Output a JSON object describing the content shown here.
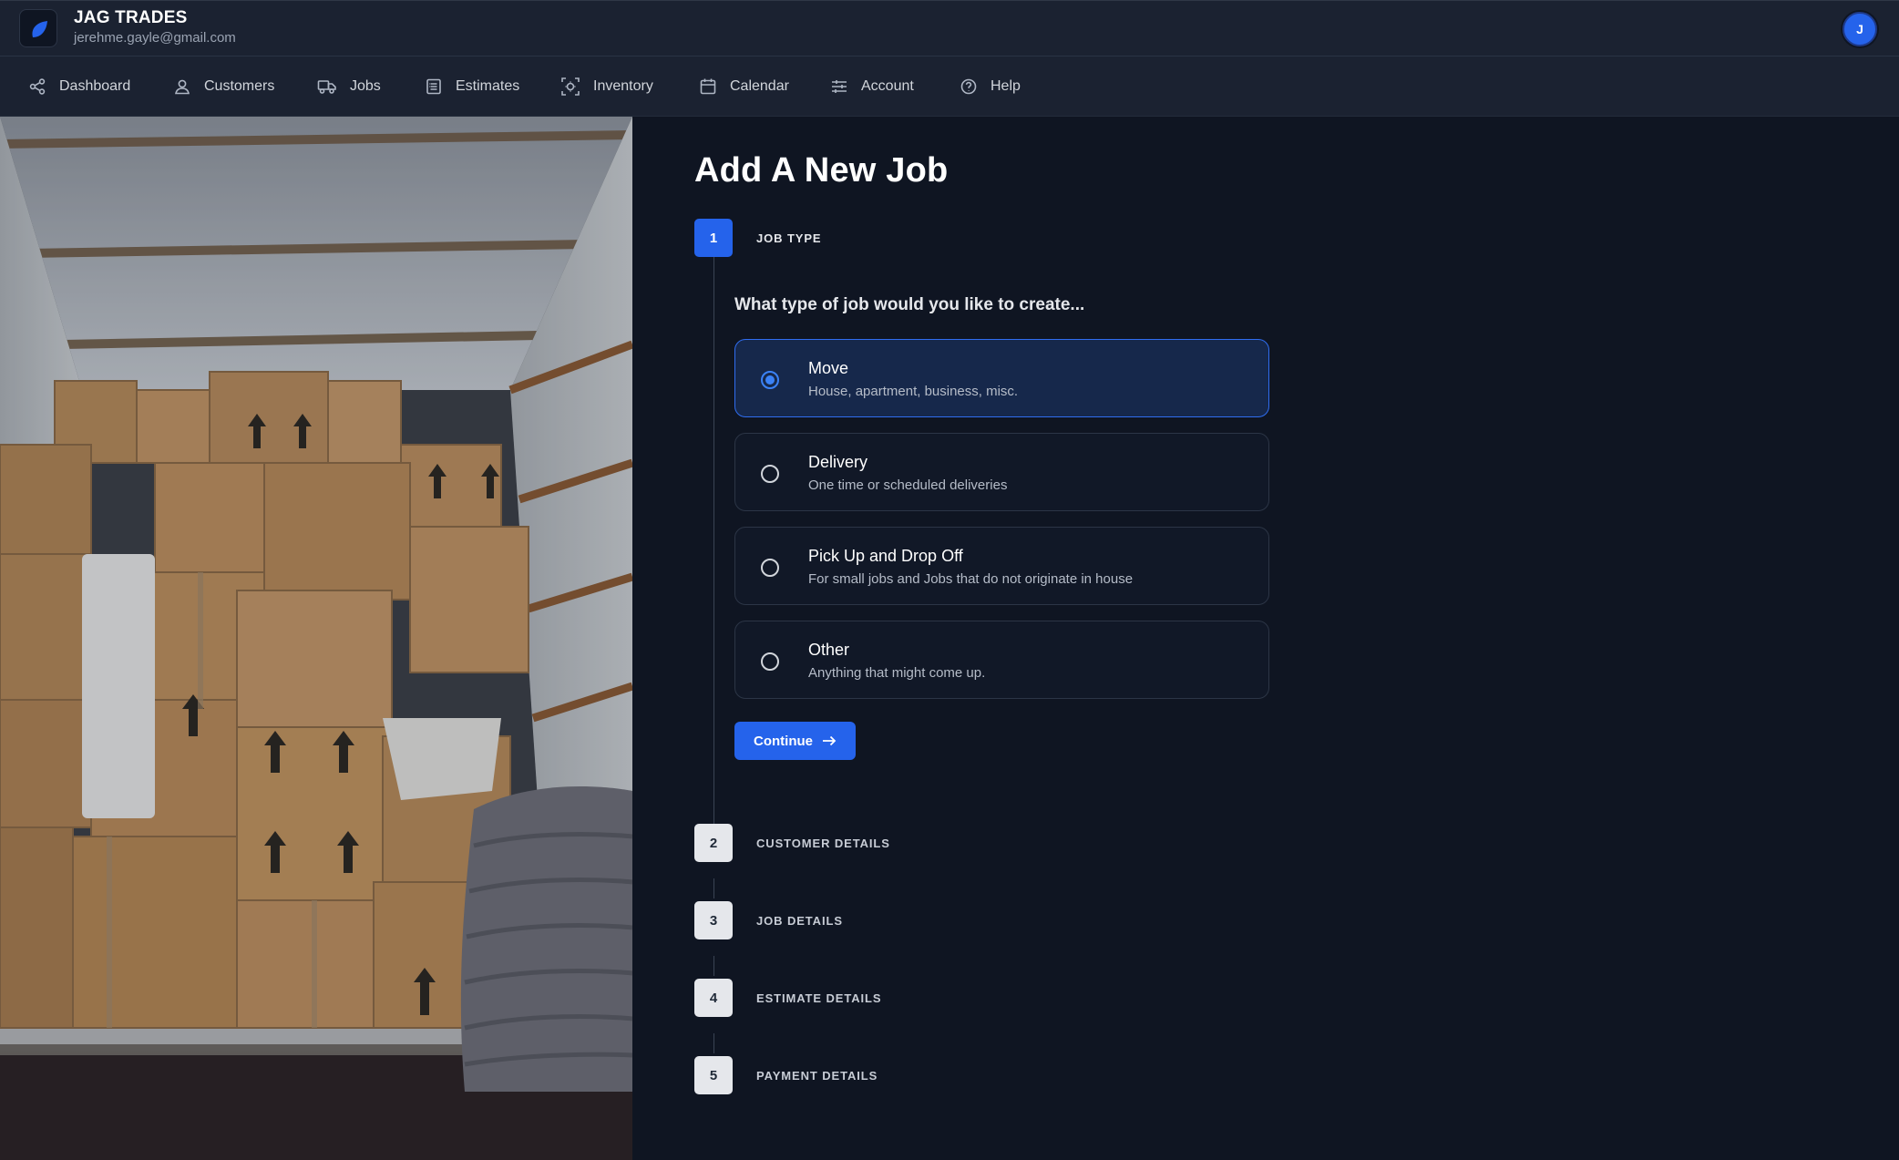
{
  "header": {
    "brand_name": "JAG TRADES",
    "email": "jerehme.gayle@gmail.com",
    "avatar_initial": "J",
    "logo_icon": "leaf-icon"
  },
  "nav": {
    "items": [
      {
        "label": "Dashboard",
        "icon": "share-nodes-icon"
      },
      {
        "label": "Customers",
        "icon": "user-icon"
      },
      {
        "label": "Jobs",
        "icon": "truck-icon"
      },
      {
        "label": "Estimates",
        "icon": "document-list-icon"
      },
      {
        "label": "Inventory",
        "icon": "scan-icon"
      },
      {
        "label": "Calendar",
        "icon": "calendar-icon"
      },
      {
        "label": "Account",
        "icon": "sliders-icon"
      },
      {
        "label": "Help",
        "icon": "help-circle-icon"
      }
    ]
  },
  "main": {
    "title": "Add A New Job",
    "question": "What type of job would you like to create...",
    "steps": [
      {
        "number": "1",
        "label": "JOB TYPE",
        "active": true
      },
      {
        "number": "2",
        "label": "CUSTOMER DETAILS",
        "active": false
      },
      {
        "number": "3",
        "label": "JOB DETAILS",
        "active": false
      },
      {
        "number": "4",
        "label": "ESTIMATE DETAILS",
        "active": false
      },
      {
        "number": "5",
        "label": "PAYMENT DETAILS",
        "active": false
      }
    ],
    "options": [
      {
        "title": "Move",
        "description": "House, apartment, business, misc.",
        "selected": true
      },
      {
        "title": "Delivery",
        "description": "One time or scheduled deliveries",
        "selected": false
      },
      {
        "title": "Pick Up and Drop Off",
        "description": "For small jobs and Jobs that do not originate in house",
        "selected": false
      },
      {
        "title": "Other",
        "description": "Anything that might come up.",
        "selected": false
      }
    ],
    "continue_label": "Continue"
  },
  "colors": {
    "accent": "#2563eb",
    "background": "#0f1522",
    "nav_background": "#1b2231",
    "selected_option_bg": "#16284b"
  }
}
